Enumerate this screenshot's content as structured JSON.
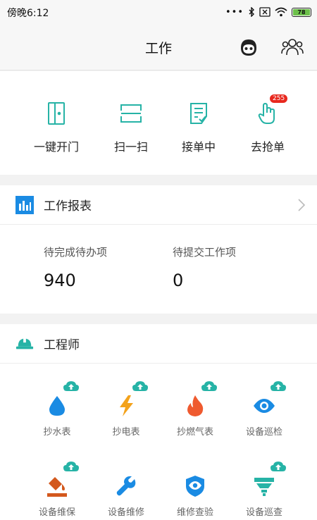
{
  "status_bar": {
    "time": "傍晚6:12",
    "dots": "•••",
    "battery": "78"
  },
  "header": {
    "title": "工作"
  },
  "quick_actions": [
    {
      "label": "一键开门",
      "icon": "door-icon"
    },
    {
      "label": "扫一扫",
      "icon": "scan-icon"
    },
    {
      "label": "接单中",
      "icon": "order-list-icon"
    },
    {
      "label": "去抢单",
      "icon": "grab-hand-icon",
      "badge": "255"
    }
  ],
  "report": {
    "title": "工作报表",
    "stats": [
      {
        "label": "待完成待办项",
        "value": "940"
      },
      {
        "label": "待提交工作项",
        "value": "0"
      }
    ]
  },
  "engineer": {
    "title": "工程师",
    "items": [
      {
        "label": "抄水表",
        "icon": "water-drop-icon",
        "cloud": true
      },
      {
        "label": "抄电表",
        "icon": "lightning-icon",
        "cloud": true
      },
      {
        "label": "抄燃气表",
        "icon": "flame-icon",
        "cloud": true
      },
      {
        "label": "设备巡检",
        "icon": "eye-icon",
        "cloud": true
      },
      {
        "label": "设备维保",
        "icon": "paint-bucket-icon",
        "cloud": true
      },
      {
        "label": "设备维修",
        "icon": "wrench-icon",
        "cloud": false
      },
      {
        "label": "维修查验",
        "icon": "shield-eye-icon",
        "cloud": false
      },
      {
        "label": "设备巡查",
        "icon": "funnel-icon",
        "cloud": true
      }
    ]
  },
  "colors": {
    "teal": "#26b3a6",
    "blue": "#1a8be3",
    "orange": "#f3a21b",
    "red": "#e8281e",
    "flame": "#ef5a2f",
    "brown": "#d3581d"
  }
}
